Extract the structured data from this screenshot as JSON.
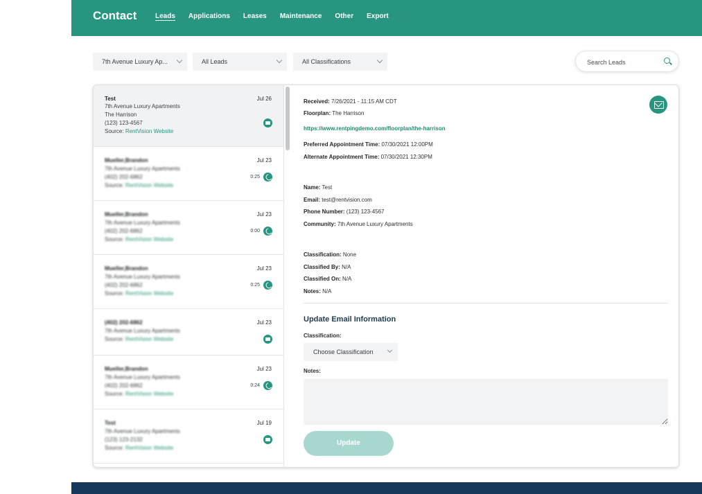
{
  "header": {
    "title": "Contact",
    "nav": [
      "Leads",
      "Applications",
      "Leases",
      "Maintenance",
      "Other",
      "Export"
    ],
    "active_nav": "Leads",
    "accent_color": "#27957f"
  },
  "filters": {
    "community": "7th Avenue Luxury Ap...",
    "leads": "All Leads",
    "classifications": "All Classifications",
    "search_placeholder": "Search Leads"
  },
  "leads": [
    {
      "name": "Test",
      "community": "7th Avenue Luxury Apartments",
      "floorplan": "The Harrison",
      "phone": "(123) 123-4567",
      "source_label": "Source:",
      "source": "RentVision Website",
      "date": "Jul 26",
      "type": "mail-icon",
      "duration": ""
    },
    {
      "name": "Mueller,Brandon",
      "community": "7th Avenue Luxury Apartments",
      "phone": "(402) 202-6862",
      "source_label": "Source:",
      "source": "RentVision Website",
      "date": "Jul 23",
      "type": "phone-icon",
      "duration": "0:25"
    },
    {
      "name": "Mueller,Brandon",
      "community": "7th Avenue Luxury Apartments",
      "phone": "(402) 202-6862",
      "source_label": "Source:",
      "source": "RentVision Website",
      "date": "Jul 23",
      "type": "phone-icon",
      "duration": "0:00"
    },
    {
      "name": "Mueller,Brandon",
      "community": "7th Avenue Luxury Apartments",
      "phone": "(402) 202-6862",
      "source_label": "Source:",
      "source": "RentVision Website",
      "date": "Jul 23",
      "type": "phone-icon",
      "duration": "0:25"
    },
    {
      "name": "(402) 202-6862",
      "community": "7th Avenue Luxury Apartments",
      "source_label": "Source:",
      "source": "RentVision Website",
      "date": "Jul 23",
      "type": "chat-icon",
      "duration": ""
    },
    {
      "name": "Mueller,Brandon",
      "community": "7th Avenue Luxury Apartments",
      "phone": "(402) 202-6862",
      "source_label": "Source:",
      "source": "RentVision Website",
      "date": "Jul 23",
      "type": "phone-icon",
      "duration": "0:24"
    },
    {
      "name": "Test",
      "community": "7th Avenue Luxury Apartments",
      "phone": "(123) 123-2132",
      "source_label": "Source:",
      "source": "RentVision Website",
      "date": "Jul 19",
      "type": "mail-icon",
      "duration": ""
    }
  ],
  "detail": {
    "received_label": "Received:",
    "received": "7/26/2021 - 11:15 AM CDT",
    "floorplan_label": "Floorplan:",
    "floorplan": "The Harrison",
    "url": "https://www.rentpingdemo.com/floorplan/the-harrison",
    "pref_label": "Preferred Appointment Time:",
    "pref": "07/30/2021 12:00PM",
    "alt_label": "Alternate Appointment Time:",
    "alt": "07/30/2021 12:30PM",
    "name_label": "Name:",
    "name": "Test",
    "email_label": "Email:",
    "email": "test@rentvision.com",
    "phone_label": "Phone Number:",
    "phone": "(123) 123-4567",
    "community_label": "Community:",
    "community": "7th Avenue Luxury Apartments",
    "class_label": "Classification:",
    "class": "None",
    "classby_label": "Classified By:",
    "classby": "N/A",
    "classon_label": "Classified On:",
    "classon": "N/A",
    "notes_label": "Notes:",
    "notes": "N/A"
  },
  "update": {
    "heading": "Update Email Information",
    "classification_label": "Classification:",
    "classification_select": "Choose Classification",
    "notes_label": "Notes:",
    "button": "Update"
  }
}
